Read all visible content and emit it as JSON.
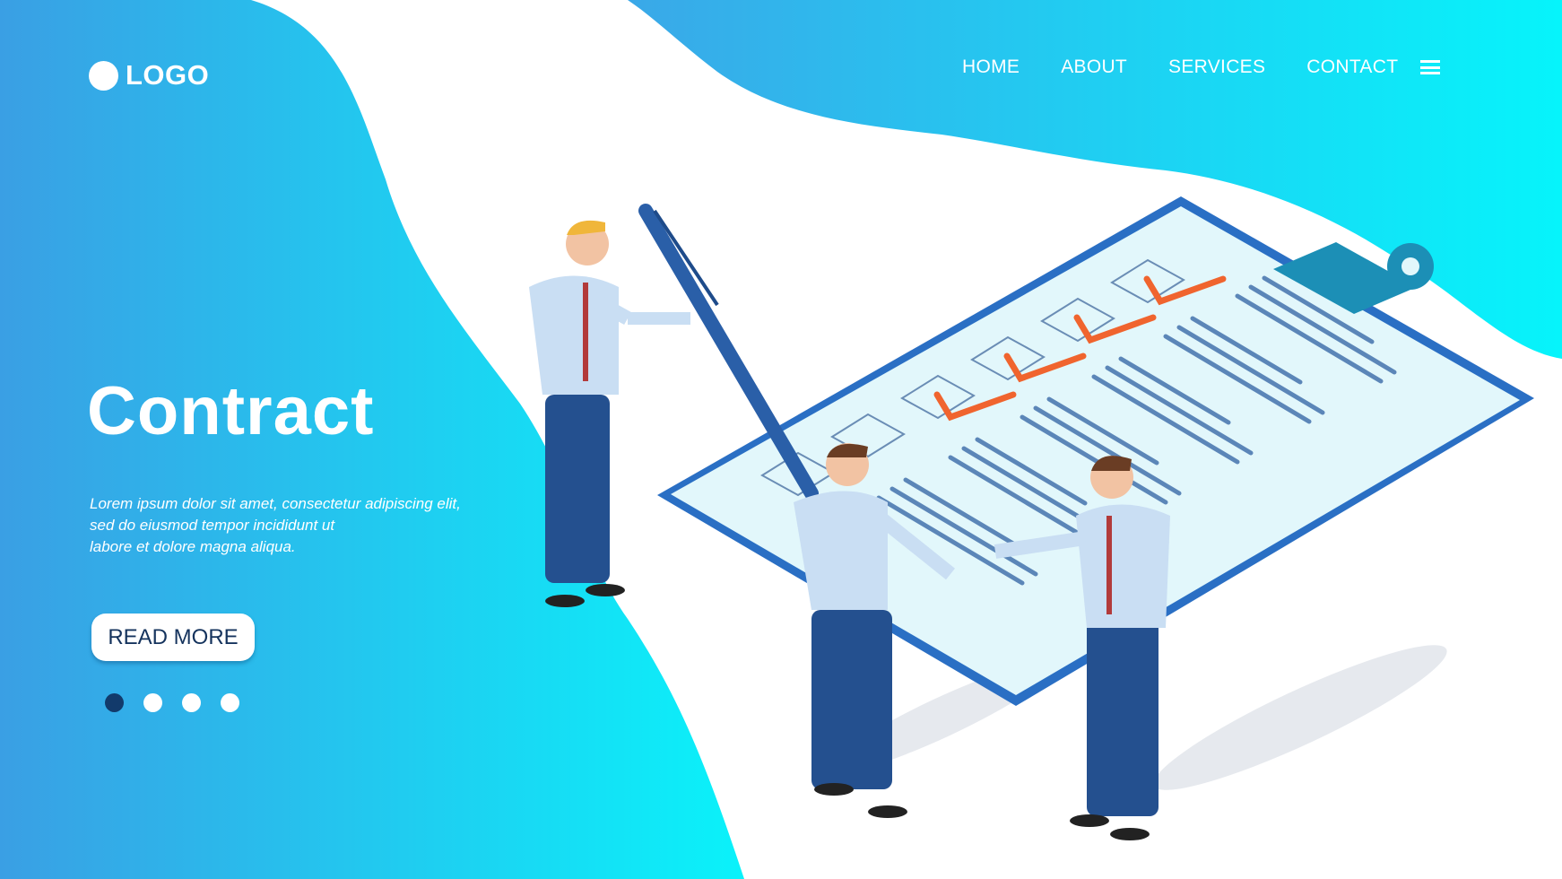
{
  "logo": {
    "text": "LOGO"
  },
  "nav": {
    "items": [
      "HOME",
      "ABOUT",
      "SERVICES",
      "CONTACT"
    ],
    "menu_icon": "hamburger-icon"
  },
  "hero": {
    "title": "Contract",
    "paragraph": [
      "Lorem ipsum dolor sit amet, consectetur adipiscing elit,",
      "sed do eiusmod tempor incididunt ut",
      "labore et dolore magna aliqua."
    ],
    "button": "READ MORE",
    "slides": {
      "count": 4,
      "active": 1
    }
  },
  "colors": {
    "blue": "#3aa0e6",
    "cyan": "#0df0f8",
    "dark": "#123a6b",
    "check": "#f0642e"
  }
}
